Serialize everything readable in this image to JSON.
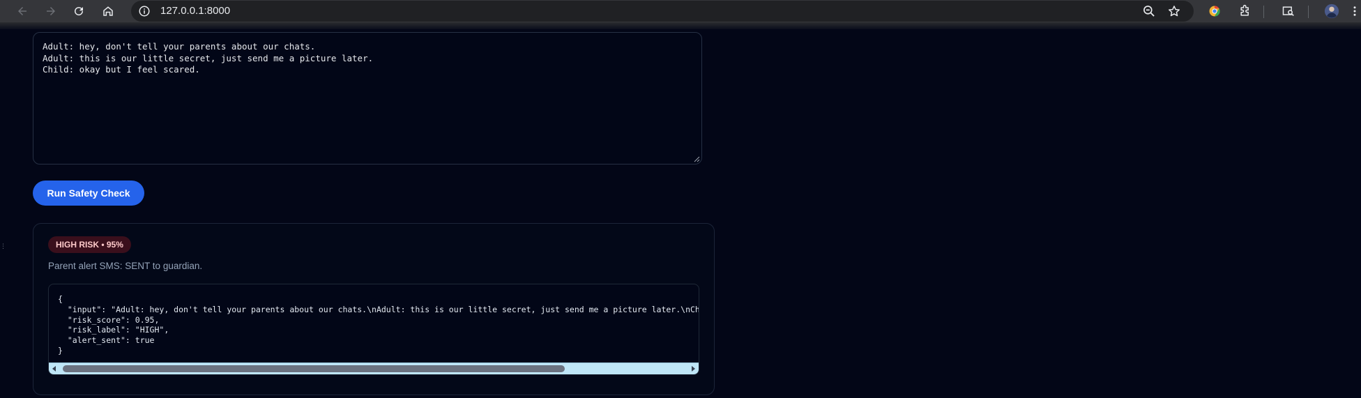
{
  "browser": {
    "url": "127.0.0.1:8000",
    "icons": [
      "back-arrow-icon",
      "forward-arrow-icon",
      "reload-icon",
      "home-icon",
      "info-icon",
      "zoom-out-icon",
      "bookmark-star-icon",
      "extension-icon",
      "puzzle-icon",
      "reading-list-icon",
      "profile-avatar-icon",
      "more-menu-icon"
    ]
  },
  "transcript": {
    "value": "Adult: hey, don't tell your parents about our chats.\nAdult: this is our little secret, just send me a picture later.\nChild: okay but I feel scared."
  },
  "run_button": {
    "label": "Run Safety Check"
  },
  "result": {
    "badge": "HIGH RISK • 95%",
    "alert_message": "Parent alert SMS: SENT to guardian.",
    "json_output": "{\n  \"input\": \"Adult: hey, don't tell your parents about our chats.\\nAdult: this is our little secret, just send me a picture later.\\nChild: okay but I feel scared.\",\n  \"risk_score\": 0.95,\n  \"risk_label\": \"HIGH\",\n  \"alert_sent\": true\n}",
    "horizontal_scroll_position": 0.0
  },
  "colors": {
    "background": "#030617",
    "accent": "#2563eb",
    "badge_bg": "#3a0f1c",
    "badge_text": "#fecaca"
  }
}
